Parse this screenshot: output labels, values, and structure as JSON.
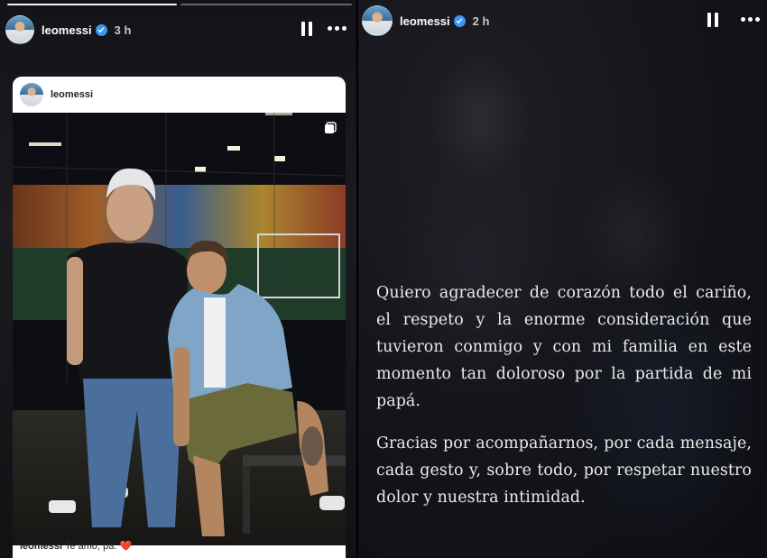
{
  "left_story": {
    "header": {
      "username": "leomessi",
      "time": "3 h"
    },
    "post": {
      "username": "leomessi",
      "caption_user": "leomessi",
      "caption_text": "Te amo, pa.",
      "caption_emoji": "❤️"
    }
  },
  "right_story": {
    "header": {
      "username": "leomessi",
      "time": "2 h"
    },
    "paragraphs": [
      "Quiero agradecer de corazón todo el cariño, el respeto y la enorme consideración que tuvieron conmigo y con mi familia en este momento tan doloroso por la partida de mi papá.",
      "Gracias por acompañarnos, por cada mensaje, cada gesto y, sobre todo, por respetar nuestro dolor y nuestra intimidad."
    ]
  },
  "colors": {
    "verified": "#3897f0",
    "heart": "#e0245e",
    "background": "#0c0c10"
  },
  "icons": [
    "verified-icon",
    "pause-icon",
    "more-icon",
    "multi-photo-icon"
  ]
}
